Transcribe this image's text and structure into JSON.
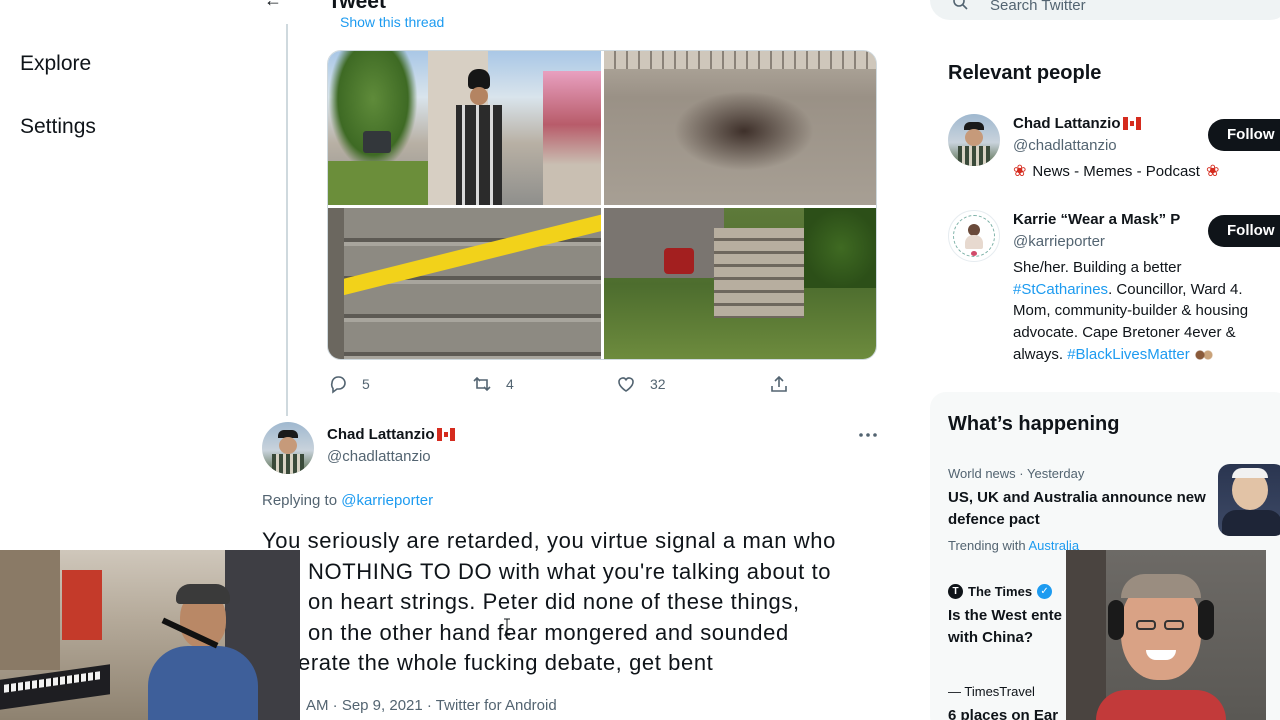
{
  "nav": {
    "explore": "Explore",
    "settings": "Settings"
  },
  "header": {
    "title": "Tweet",
    "search_placeholder": "Search Twitter"
  },
  "parent_tweet": {
    "show_thread": "Show this thread",
    "actions": {
      "replies": "5",
      "retweets": "4",
      "likes": "32"
    }
  },
  "reply_tweet": {
    "author_name": "Chad Lattanzio",
    "author_handle": "@chadlattanzio",
    "replying_prefix": "Replying to",
    "replying_to": "@karrieporter",
    "body_lines": [
      "You seriously are retarded, you virtue signal a man who",
      "NOTHING TO DO with what you're talking about to",
      "on heart strings. Peter did none of these things,",
      "on the other hand fear mongered and sounded",
      "erate the whole fucking debate, get bent"
    ],
    "meta": "AM · Sep 9, 2021 · Twitter for Android"
  },
  "relevant_people": {
    "title": "Relevant people",
    "people": [
      {
        "name": "Chad Lattanzio",
        "handle": "@chadlattanzio",
        "bio": "News - Memes - Podcast",
        "follow_label": "Follow"
      },
      {
        "name": "Karrie “Wear a Mask” P",
        "handle": "@karrieporter",
        "bio_line1": "She/her. Building a better",
        "bio_hashtag1": "#StCatharines",
        "bio_line2": ". Councillor, Ward 4.",
        "bio_line3": "Mom, community-builder & housing",
        "bio_line4": "advocate. Cape Bretoner 4ever &",
        "bio_line5": "always.",
        "bio_hashtag2": "#BlackLivesMatter",
        "follow_label": "Follow"
      }
    ]
  },
  "whats_happening": {
    "title": "What’s happening",
    "trends": [
      {
        "meta": "World news · Yesterday",
        "title": "US, UK and Australia announce new defence pact",
        "trending_with_label": "Trending with",
        "trending_with": "Australia"
      },
      {
        "source": "The Times",
        "title": "Is the West ente with China?"
      },
      {
        "source": "TimesTravel",
        "title": "6 places on Ear"
      }
    ]
  },
  "colors": {
    "accent": "#1d9bf0",
    "text": "#0f1419",
    "muted": "#536471",
    "card_bg": "#f7f9f9",
    "button_bg": "#0f1419"
  }
}
